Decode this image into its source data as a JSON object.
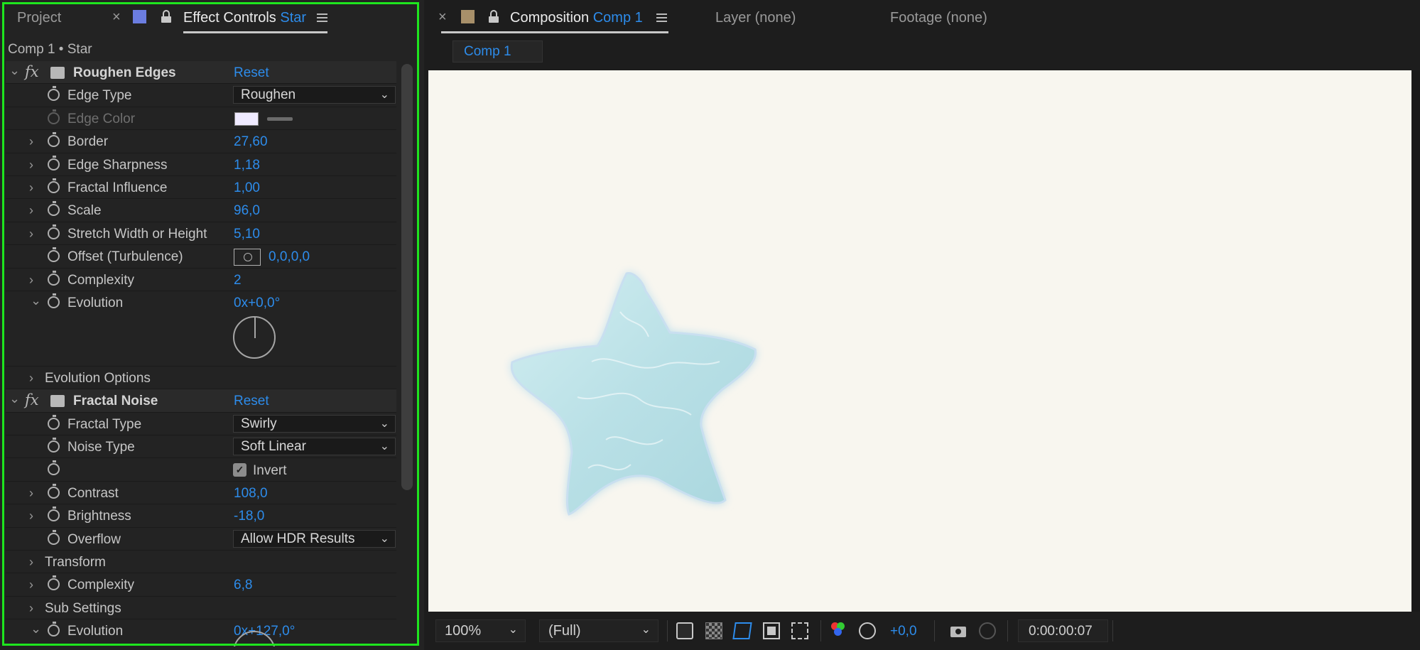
{
  "left_panel": {
    "tab_project": "Project",
    "tab_effect_controls": "Effect Controls",
    "tab_effect_layer": "Star",
    "subtitle": "Comp 1 • Star",
    "layer_color": "#6b7de0",
    "rows": {
      "roughen_edges": {
        "label": "Roughen Edges",
        "reset": "Reset"
      },
      "edge_type": {
        "label": "Edge Type",
        "value": "Roughen"
      },
      "edge_color": {
        "label": "Edge Color",
        "color": "#efeaff"
      },
      "border": {
        "label": "Border",
        "value": "27,60"
      },
      "edge_sharpness": {
        "label": "Edge Sharpness",
        "value": "1,18"
      },
      "fractal_influence": {
        "label": "Fractal Influence",
        "value": "1,00"
      },
      "scale": {
        "label": "Scale",
        "value": "96,0"
      },
      "stretch": {
        "label": "Stretch Width or Height",
        "value": "5,10"
      },
      "offset": {
        "label": "Offset (Turbulence)",
        "value": "0,0,0,0"
      },
      "complexity": {
        "label": "Complexity",
        "value": "2"
      },
      "evolution": {
        "label": "Evolution",
        "value": "0x+0,0°"
      },
      "evolution_options": {
        "label": "Evolution Options"
      },
      "fractal_noise": {
        "label": "Fractal Noise",
        "reset": "Reset"
      },
      "fractal_type": {
        "label": "Fractal Type",
        "value": "Swirly"
      },
      "noise_type": {
        "label": "Noise Type",
        "value": "Soft Linear"
      },
      "invert": {
        "label": "Invert",
        "checked": true
      },
      "contrast": {
        "label": "Contrast",
        "value": "108,0"
      },
      "brightness": {
        "label": "Brightness",
        "value": "-18,0"
      },
      "overflow": {
        "label": "Overflow",
        "value": "Allow HDR Results"
      },
      "transform": {
        "label": "Transform"
      },
      "complexity2": {
        "label": "Complexity",
        "value": "6,8"
      },
      "sub_settings": {
        "label": "Sub Settings"
      },
      "evolution2": {
        "label": "Evolution",
        "value": "0x+127,0°"
      }
    }
  },
  "right_panel": {
    "tab_composition": "Composition",
    "tab_comp_name": "Comp 1",
    "tab_layer": "Layer (none)",
    "tab_footage": "Footage (none)",
    "comp_chip": "Comp 1",
    "comp_color": "#a8906a",
    "viewer_bg": "#f8f6ef",
    "star_color": "#bfe3e8"
  },
  "bottom_bar": {
    "zoom": "100%",
    "resolution": "(Full)",
    "exposure": "+0,0",
    "timecode": "0:00:00:07"
  },
  "accent_color": "#2d8ceb",
  "focus_outline_color": "#1ee51e"
}
